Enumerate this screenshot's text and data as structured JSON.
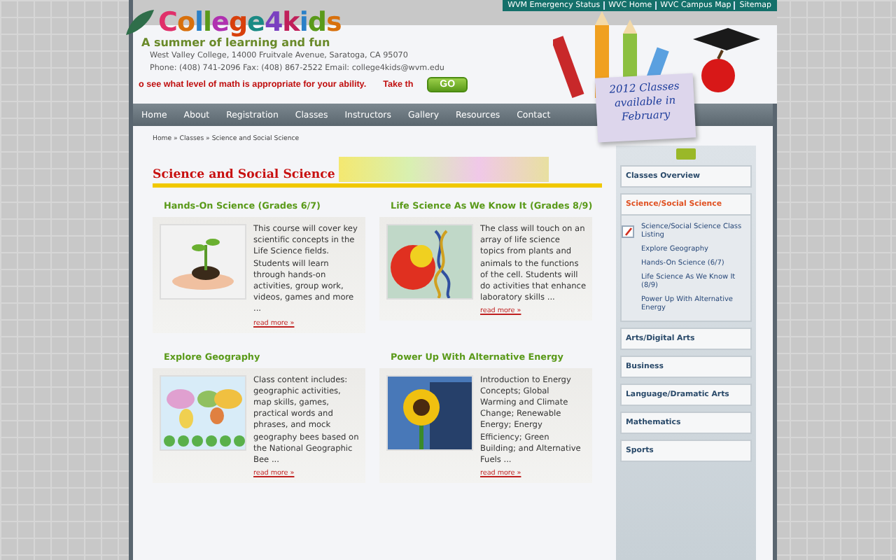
{
  "top_links": [
    "WVM Emergency Status",
    "WVC Home",
    "WVC Campus Map",
    "Sitemap"
  ],
  "logo": "College4kids",
  "tagline": "A summer of learning and fun",
  "address": "West Valley College, 14000 Fruitvale Avenue, Saratoga, CA 95070",
  "contact": "Phone: (408) 741-2096 Fax: (408) 867-2522 Email: college4kids@wvm.edu",
  "marquee": [
    "o see what level of math is appropriate for your ability.",
    "Take th"
  ],
  "go_button": "GO",
  "note": "2012 Classes available in February",
  "nav": [
    {
      "label": "Home",
      "selected": false
    },
    {
      "label": "About",
      "selected": false
    },
    {
      "label": "Registration",
      "selected": false
    },
    {
      "label": "Classes",
      "selected": false
    },
    {
      "label": "Instructors",
      "selected": false
    },
    {
      "label": "Gallery",
      "selected": false
    },
    {
      "label": "Resources",
      "selected": false
    },
    {
      "label": "Contact",
      "selected": false
    }
  ],
  "breadcrumb": "Home » Classes » Science and Social Science",
  "heading": "Science and Social Science",
  "cards": [
    {
      "title": "Hands-On Science (Grades 6/7)",
      "kind": "plant",
      "text": "This course will cover key scientific concepts in the Life Science fields. Students will learn through hands-on activities, group work, videos, games and more ...",
      "link": "read more »"
    },
    {
      "title": "Life Science As We Know It (Grades 8/9)",
      "kind": "dna",
      "text": "The class will touch on an array of life science topics from plants and animals to the functions of the cell. Students will do activities that enhance laboratory skills ...",
      "link": "read more »"
    },
    {
      "title": "Explore Geography",
      "kind": "map",
      "text": "Class content includes: geographic activities, map skills, games, practical words and phrases, and mock geography bees based on the National Geographic Bee ...",
      "link": "read more »"
    },
    {
      "title": "Power Up With Alternative Energy",
      "kind": "sun",
      "text": "Introduction to Energy Concepts; Global Warming and Climate Change; Renewable Energy; Energy Efficiency; Green Building; and Alternative Fuels ...",
      "link": "read more »"
    }
  ],
  "sidebar": [
    {
      "label": "Classes Overview",
      "expanded": false
    },
    {
      "label": "Science/Social Science",
      "expanded": true,
      "children": [
        "Science/Social Science Class Listing",
        "Explore Geography",
        "Hands-On Science (6/7)",
        "Life Science As We Know It (8/9)",
        "Power Up With Alternative Energy"
      ]
    },
    {
      "label": "Arts/Digital Arts",
      "expanded": false
    },
    {
      "label": "Business",
      "expanded": false
    },
    {
      "label": "Language/Dramatic Arts",
      "expanded": false
    },
    {
      "label": "Mathematics",
      "expanded": false
    },
    {
      "label": "Sports",
      "expanded": false
    }
  ]
}
